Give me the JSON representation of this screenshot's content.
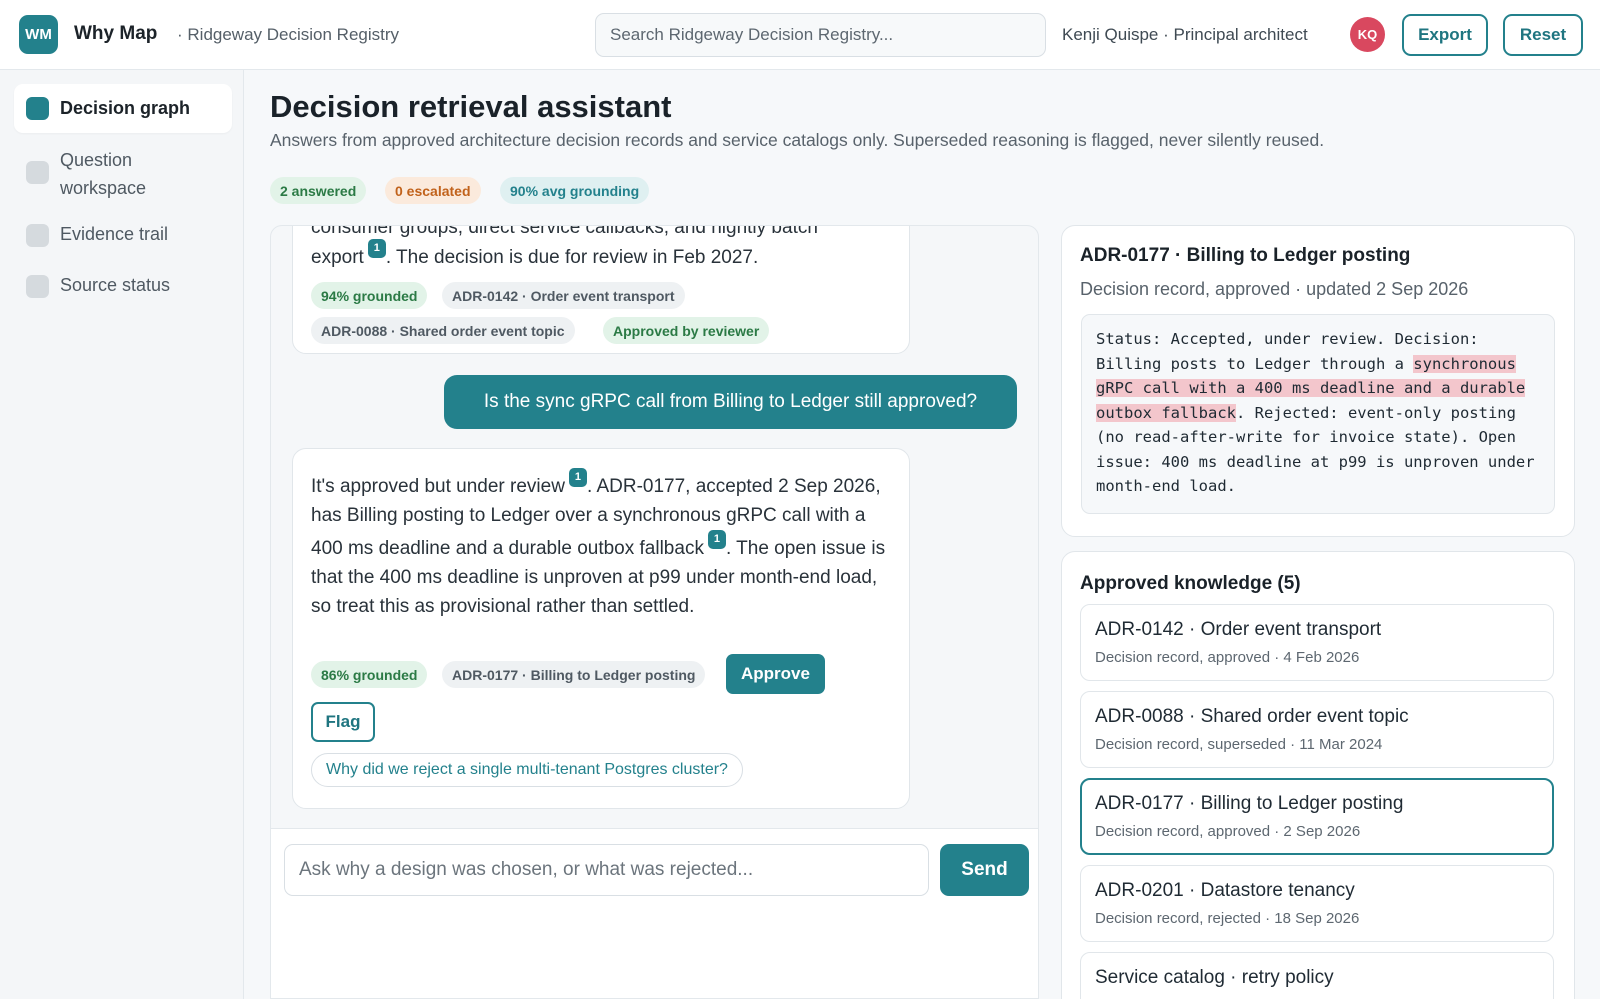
{
  "app": {
    "logo_text": "WM",
    "name": "Why Map",
    "registry": "· Ridgeway Decision Registry"
  },
  "search": {
    "placeholder": "Search Ridgeway Decision Registry..."
  },
  "user": {
    "label": "Kenji Quispe · Principal architect",
    "initials": "KQ"
  },
  "toolbar": {
    "export_label": "Export",
    "reset_label": "Reset"
  },
  "sidebar": {
    "items": [
      {
        "label": "Decision graph",
        "active": true
      },
      {
        "label": "Question workspace"
      },
      {
        "label": "Evidence trail"
      },
      {
        "label": "Source status"
      }
    ]
  },
  "header": {
    "title": "Decision retrieval assistant",
    "subtitle": "Answers from approved architecture decision records and service catalogs only. Superseded reasoning is flagged, never silently reused.",
    "stats": {
      "answered": "2 answered",
      "escalated": "0 escalated",
      "grounding": "90% avg grounding"
    }
  },
  "chat": {
    "msg1": {
      "text_partial": "consumer groups, direct service callbacks, and nightly batch",
      "text_line2_a": "export",
      "cite": "1",
      "text_line2_b": ". The decision is due for review in Feb 2027.",
      "chips": [
        "94% grounded",
        "ADR-0142 · Order event transport",
        "ADR-0088 · Shared order event topic",
        "Approved by reviewer"
      ]
    },
    "user_msg": "Is the sync gRPC call from Billing to Ledger still approved?",
    "msg2": {
      "text_a": "It's approved but under review",
      "cite_a": "1",
      "text_b": ". ADR-0177, accepted 2 Sep 2026, has Billing posting to Ledger over a synchronous gRPC call with a 400 ms deadline and a durable outbox fallback",
      "cite_b": "1",
      "text_c": ". The open issue is that the 400 ms deadline is unproven at p99 under month-end load, so treat this as provisional rather than settled.",
      "chips": [
        "86% grounded",
        "ADR-0177 · Billing to Ledger posting"
      ],
      "approve_label": "Approve",
      "flag_label": "Flag",
      "suggestion": "Why did we reject a single multi-tenant Postgres cluster?"
    },
    "composer": {
      "placeholder": "Ask why a design was chosen, or what was rejected...",
      "send_label": "Send"
    }
  },
  "detail": {
    "title": "ADR-0177 · Billing to Ledger posting",
    "meta": "Decision record, approved · updated 2 Sep 2026",
    "body_pre": "Status: Accepted, under review. Decision: Billing posts to Ledger through a ",
    "body_highlight": "synchronous gRPC call with a 400 ms deadline and a durable outbox fallback",
    "body_post": ". Rejected: event-only posting (no read-after-write for invoice state). Open issue: 400 ms deadline at p99 is unproven under month-end load."
  },
  "knowledge": {
    "title": "Approved knowledge (5)",
    "items": [
      {
        "title": "ADR-0142 · Order event transport",
        "meta": "Decision record, approved · 4 Feb 2026"
      },
      {
        "title": "ADR-0088 · Shared order event topic",
        "meta": "Decision record, superseded · 11 Mar 2024"
      },
      {
        "title": "ADR-0177 · Billing to Ledger posting",
        "meta": "Decision record, approved · 2 Sep 2026",
        "selected": true
      },
      {
        "title": "ADR-0201 · Datastore tenancy",
        "meta": "Decision record, rejected · 18 Sep 2026"
      },
      {
        "title": "Service catalog · retry policy",
        "meta": ""
      }
    ]
  },
  "colors": {
    "accent": "#23818c",
    "avatar": "#d9485f",
    "highlight": "#f3c6cc"
  }
}
